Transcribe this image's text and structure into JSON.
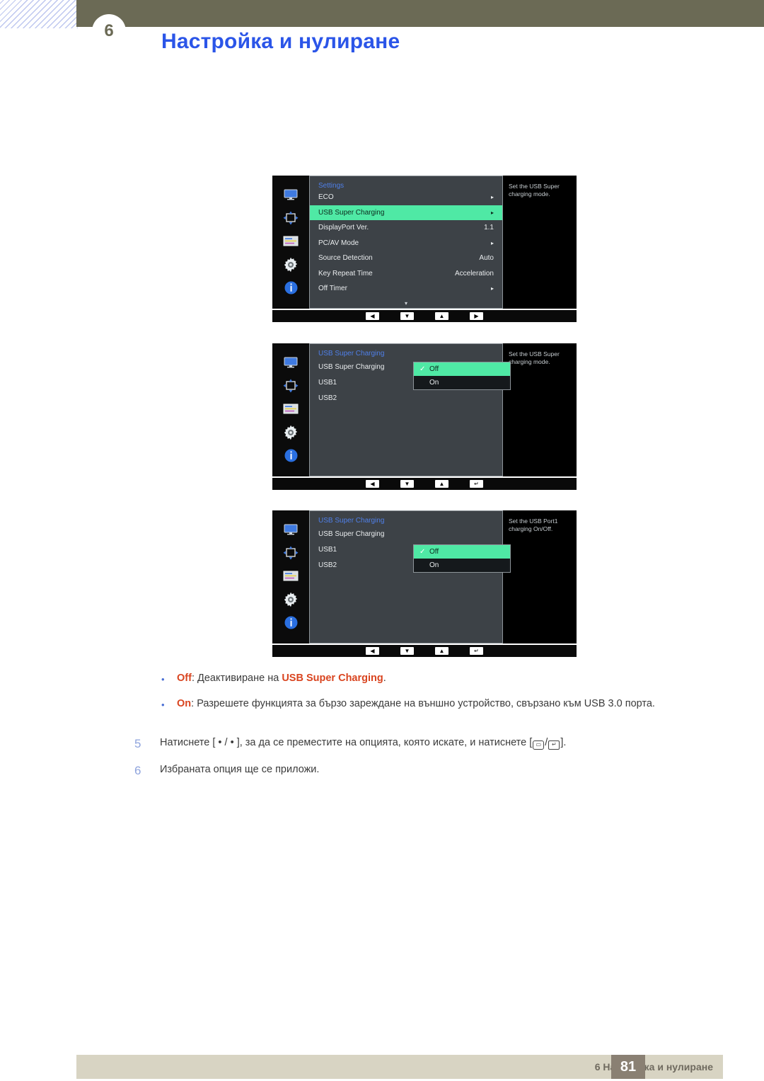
{
  "header": {
    "chapter_number": "6",
    "title": "Настройка и нулиране"
  },
  "osd_screens": [
    {
      "id": "settings-menu",
      "menu_title": "Settings",
      "help_text": "Set the USB Super charging mode.",
      "rows": [
        {
          "label": "ECO",
          "value": "▸",
          "selected": false
        },
        {
          "label": "USB Super Charging",
          "value": "▸",
          "selected": true
        },
        {
          "label": "DisplayPort Ver.",
          "value": "1.1",
          "selected": false
        },
        {
          "label": "PC/AV Mode",
          "value": "▸",
          "selected": false
        },
        {
          "label": "Source Detection",
          "value": "Auto",
          "selected": false
        },
        {
          "label": "Key Repeat Time",
          "value": "Acceleration",
          "selected": false
        },
        {
          "label": "Off Timer",
          "value": "▸",
          "selected": false
        }
      ],
      "scroll_caret": "▾",
      "nav_keys": [
        "◀",
        "▼",
        "▲",
        "▶"
      ]
    },
    {
      "id": "usb-super-charging-menu",
      "menu_title": "USB Super Charging",
      "help_text": "Set the USB Super charging mode.",
      "rows": [
        {
          "label": "USB Super Charging",
          "selected": true
        },
        {
          "label": "USB1",
          "selected": false
        },
        {
          "label": "USB2",
          "selected": false
        }
      ],
      "popup_options": [
        {
          "label": "Off",
          "checked": true,
          "selected": true
        },
        {
          "label": "On",
          "checked": false,
          "selected": false
        }
      ],
      "nav_keys": [
        "◀",
        "▼",
        "▲",
        "↵"
      ]
    },
    {
      "id": "usb1-charging-menu",
      "menu_title": "USB Super Charging",
      "help_text": "Set the USB Port1 charging On/Off.",
      "rows": [
        {
          "label": "USB Super Charging",
          "selected": false
        },
        {
          "label": "USB1",
          "selected": true
        },
        {
          "label": "USB2",
          "selected": false
        }
      ],
      "popup_options": [
        {
          "label": "Off",
          "checked": true,
          "selected": true
        },
        {
          "label": "On",
          "checked": false,
          "selected": false
        }
      ],
      "nav_keys": [
        "◀",
        "▼",
        "▲",
        "↵"
      ]
    }
  ],
  "rail_icons": [
    "monitor-icon",
    "move-arrows-icon",
    "onscreen-display-icon",
    "gear-icon",
    "info-icon"
  ],
  "bullets": [
    {
      "keyword": "Off",
      "text_before": ": Деактивиране на ",
      "highlight": "USB Super Charging",
      "text_after": "."
    },
    {
      "keyword": "On",
      "text_before": ": Разрешете функцията за бързо зареждане на външно устройство, свързано към USB 3.0 порта.",
      "highlight": "",
      "text_after": ""
    }
  ],
  "steps": [
    {
      "number": "5",
      "part1": "Натиснете [ • / • ], за да се преместите на опцията, която искате, и натиснете [",
      "key1": "▭",
      "separator": "/",
      "key2": "↵",
      "part2": "]."
    },
    {
      "number": "6",
      "part1": "Избраната опция ще се приложи.",
      "key1": "",
      "separator": "",
      "key2": "",
      "part2": ""
    }
  ],
  "footer": {
    "text": "6 Настройка и нулиране",
    "page_number": "81"
  },
  "colors": {
    "title_blue": "#2b55e8",
    "header_olive": "#6b6a55",
    "osd_green": "#4fe9a5",
    "keyword_orange": "#d9441f",
    "footer_bar": "#d8d4c3",
    "footer_page_box": "#8a8073"
  }
}
